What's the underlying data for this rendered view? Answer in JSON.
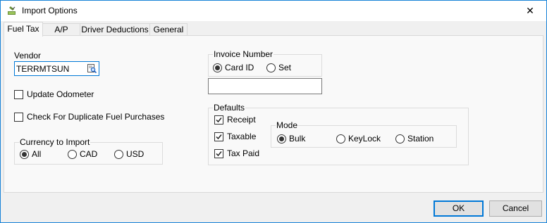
{
  "window": {
    "title": "Import Options",
    "close_glyph": "✕"
  },
  "tabs": [
    "Fuel Tax",
    "A/P",
    "Driver Deductions",
    "General"
  ],
  "vendor": {
    "label": "Vendor",
    "value": "TERRMTSUN"
  },
  "update_odometer": {
    "label": "Update Odometer",
    "checked": false
  },
  "check_duplicate": {
    "label": "Check For Duplicate Fuel Purchases",
    "checked": false
  },
  "currency": {
    "label": "Currency to Import",
    "options": [
      "All",
      "CAD",
      "USD"
    ],
    "selected": "All"
  },
  "invoice_number": {
    "label": "Invoice Number",
    "options": [
      "Card ID",
      "Set"
    ],
    "selected": "Card ID",
    "value": ""
  },
  "defaults": {
    "label": "Defaults",
    "receipt": {
      "label": "Receipt",
      "checked": true
    },
    "taxable": {
      "label": "Taxable",
      "checked": true
    },
    "tax_paid": {
      "label": "Tax Paid",
      "checked": true
    }
  },
  "mode": {
    "label": "Mode",
    "options": [
      "Bulk",
      "KeyLock",
      "Station"
    ],
    "selected": "Bulk"
  },
  "buttons": {
    "ok": "OK",
    "cancel": "Cancel"
  },
  "colors": {
    "accent": "#0078d7",
    "window_border": "#1883d7",
    "panel_bg": "#f9f9f9",
    "dialog_bg": "#f0f0f0"
  }
}
